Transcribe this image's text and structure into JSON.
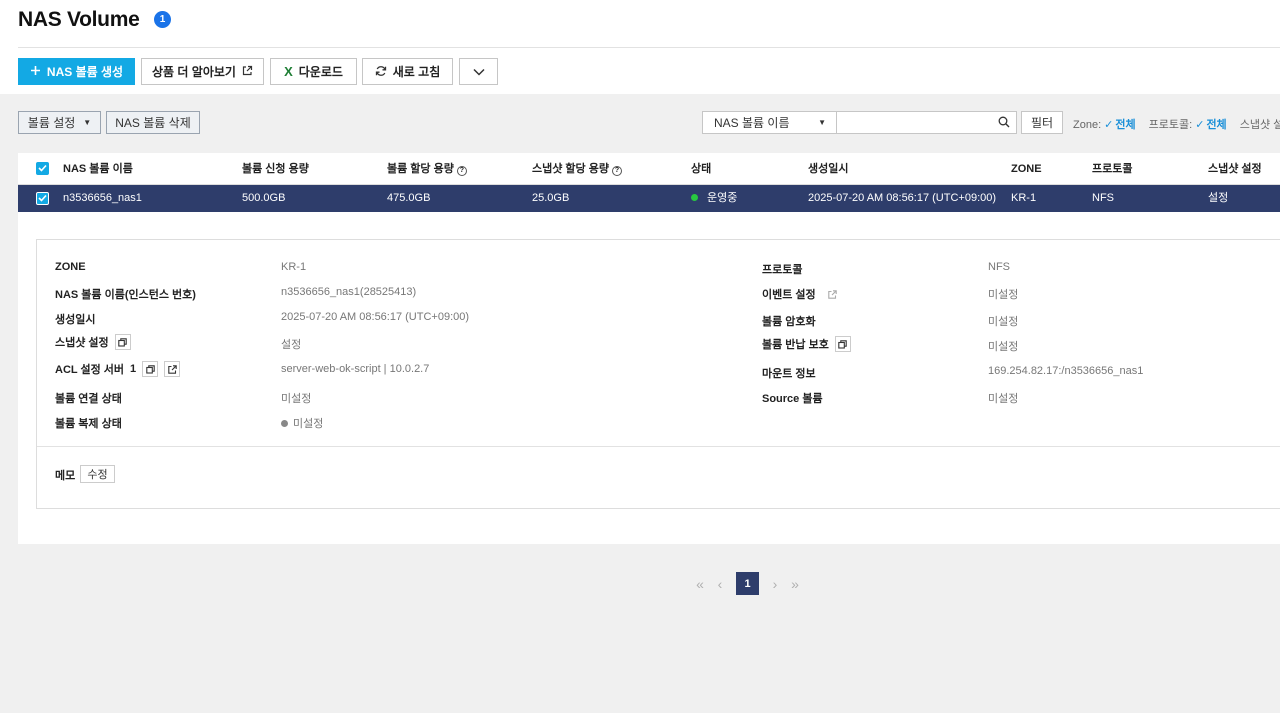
{
  "header": {
    "title": "NAS Volume",
    "count_badge": "1"
  },
  "toolbar": {
    "create_label": "NAS 볼륨 생성",
    "learn_more_label": "상품 더 알아보기",
    "download_label": "다운로드",
    "refresh_label": "새로 고침"
  },
  "actions": {
    "volume_settings_label": "볼륨 설정",
    "delete_label": "NAS 볼륨 삭제"
  },
  "search": {
    "field_selected": "NAS 볼륨 이름",
    "placeholder": "",
    "filter_label": "필터",
    "filters": [
      {
        "key": "Zone:",
        "value": "전체"
      },
      {
        "key": "프로토콜:",
        "value": "전체"
      },
      {
        "key": "스냅샷 설",
        "value": ""
      }
    ]
  },
  "table": {
    "columns": [
      "NAS 볼륨 이름",
      "볼륨 신청 용량",
      "볼륨 할당 용량",
      "스냅샷 할당 용량",
      "상태",
      "생성일시",
      "ZONE",
      "프로토콜",
      "스냅샷 설정"
    ],
    "rows": [
      {
        "name": "n3536656_nas1",
        "requested": "500.0GB",
        "allocated": "475.0GB",
        "snapshot_allocated": "25.0GB",
        "status": "운영중",
        "created": "2025-07-20 AM 08:56:17 (UTC+09:00)",
        "zone": "KR-1",
        "protocol": "NFS",
        "snapshot_setting": "설정"
      }
    ]
  },
  "detail": {
    "left": [
      {
        "label": "ZONE",
        "value": "KR-1"
      },
      {
        "label": "NAS 볼륨 이름(인스턴스 번호)",
        "value": "n3536656_nas1(28525413)"
      },
      {
        "label": "생성일시",
        "value": "2025-07-20 AM 08:56:17 (UTC+09:00)"
      },
      {
        "label": "스냅샷 설정",
        "value": "설정"
      },
      {
        "label": "ACL 설정 서버",
        "count": "1",
        "value": "server-web-ok-script | 10.0.2.7"
      },
      {
        "label": "볼륨 연결 상태",
        "value": "미설정"
      },
      {
        "label": "볼륨 복제 상태",
        "value": "미설정"
      }
    ],
    "right": [
      {
        "label": "프로토콜",
        "value": "NFS"
      },
      {
        "label": "이벤트 설정",
        "value": "미설정"
      },
      {
        "label": "볼륨 암호화",
        "value": "미설정"
      },
      {
        "label": "볼륨 반납 보호",
        "value": "미설정"
      },
      {
        "label": "마운트 정보",
        "value": "169.254.82.17:/n3536656_nas1"
      },
      {
        "label": "Source 볼륨",
        "value": "미설정"
      }
    ],
    "memo_label": "메모",
    "memo_edit_label": "수정"
  },
  "pagination": {
    "current": "1"
  },
  "colors": {
    "primary": "#13a9e4",
    "selected_row": "#2e3d6b",
    "status_running": "#28c840",
    "accent": "#1a73e8"
  },
  "icons": [
    "plus-icon",
    "external-link-icon",
    "excel-icon",
    "refresh-icon",
    "chevron-down-icon",
    "search-icon",
    "check-icon",
    "help-icon",
    "copy-icon",
    "status-dot-icon"
  ]
}
